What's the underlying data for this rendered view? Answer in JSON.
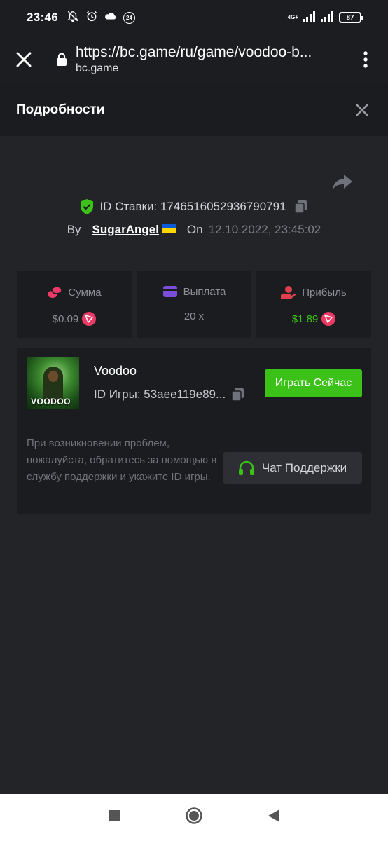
{
  "status_bar": {
    "time": "23:46",
    "badge": "24",
    "network": "4G+",
    "battery": "87"
  },
  "browser": {
    "url": "https://bc.game/ru/game/voodoo-b...",
    "domain": "bc.game"
  },
  "dialog": {
    "title": "Подробности"
  },
  "bet": {
    "id_text": "ID Ставки: 1746516052936790791",
    "by_label": "By",
    "username": "SugarAngel",
    "on_label": "On",
    "date": "12.10.2022, 23:45:02"
  },
  "stats": [
    {
      "label": "Сумма",
      "value": "$0.09"
    },
    {
      "label": "Выплата",
      "value": "20 x"
    },
    {
      "label": "Прибыль",
      "value": "$1.89"
    }
  ],
  "game": {
    "thumb_text": "VOODOO",
    "name": "Voodoo",
    "id_text": "ID Игры: 53aee119e89...",
    "play_label": "Играть Сейчас",
    "help_text": "При возникновении проблем, пожалуйста, обратитесь за помощью в службу поддержки и укажите ID игры.",
    "support_label": "Чат Поддержки"
  },
  "colors": {
    "accent_green": "#3bc117",
    "trx_red": "#ec3a66",
    "background": "#232428",
    "card": "#1b1c1f"
  }
}
